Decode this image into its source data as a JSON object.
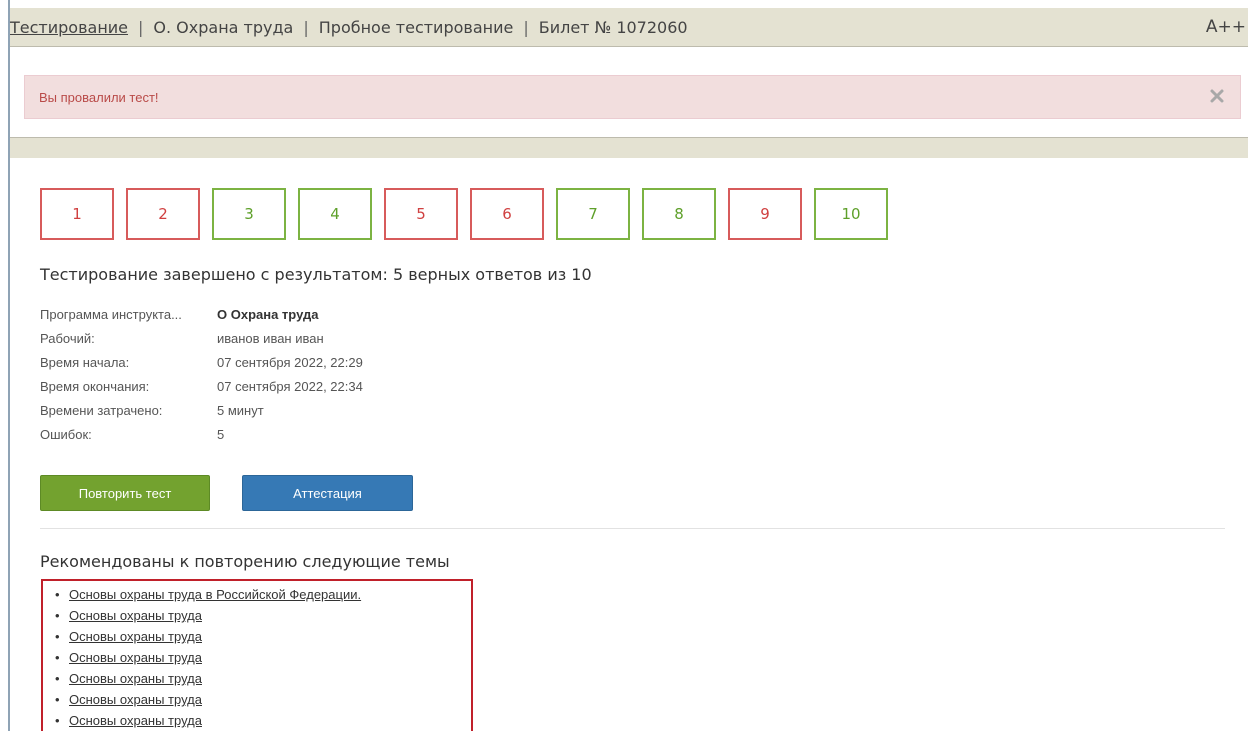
{
  "header": {
    "breadcrumb": [
      {
        "label": "Тестирование",
        "link": true
      },
      {
        "label": "О. Охрана труда",
        "link": false
      },
      {
        "label": "Пробное тестирование",
        "link": false
      },
      {
        "label": "Билет № 1072060",
        "link": false
      }
    ],
    "separator": "|",
    "font_size_toggle": "A++"
  },
  "alert": {
    "message": "Вы провалили тест!",
    "close_icon": "close-icon"
  },
  "questions": [
    {
      "number": "1",
      "status": "wrong"
    },
    {
      "number": "2",
      "status": "wrong"
    },
    {
      "number": "3",
      "status": "right"
    },
    {
      "number": "4",
      "status": "right"
    },
    {
      "number": "5",
      "status": "wrong"
    },
    {
      "number": "6",
      "status": "wrong"
    },
    {
      "number": "7",
      "status": "right"
    },
    {
      "number": "8",
      "status": "right"
    },
    {
      "number": "9",
      "status": "wrong"
    },
    {
      "number": "10",
      "status": "right"
    }
  ],
  "result": {
    "title": "Тестирование завершено с результатом: 5 верных ответов из 10"
  },
  "info": [
    {
      "label": "Программа инструкта...",
      "value": "О Охрана труда",
      "bold": true
    },
    {
      "label": "Рабочий:",
      "value": "иванов иван иван",
      "bold": false
    },
    {
      "label": "Время начала:",
      "value": "07 сентября 2022, 22:29",
      "bold": false
    },
    {
      "label": "Время окончания:",
      "value": "07 сентября 2022, 22:34",
      "bold": false
    },
    {
      "label": "Времени затрачено:",
      "value": "5 минут",
      "bold": false
    },
    {
      "label": "Ошибок:",
      "value": "5",
      "bold": false
    }
  ],
  "buttons": {
    "repeat": "Повторить тест",
    "attest": "Аттестация"
  },
  "recommendations": {
    "title": "Рекомендованы к повторению следующие темы",
    "bullet": "•",
    "topics": [
      "Основы охраны труда в Российской Федерации.",
      "Основы охраны труда",
      "Основы охраны труда",
      "Основы охраны труда",
      "Основы охраны труда",
      "Основы охраны труда",
      "Основы охраны труда"
    ]
  },
  "colors": {
    "wrong": "#d75b5b",
    "right": "#7cb342",
    "alert_bg": "#f2dede",
    "alert_text": "#b94a48",
    "btn_green": "#73a22f",
    "btn_blue": "#3679b5",
    "header_bg": "#e4e2d2",
    "topics_border": "#c0202a"
  }
}
